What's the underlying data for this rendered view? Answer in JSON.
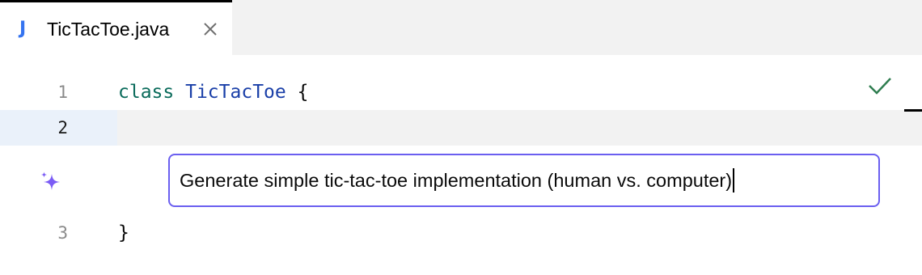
{
  "tab": {
    "icon_label": "J",
    "icon_color": "#3574f0",
    "title": "TicTacToe.java",
    "close_icon": "close-icon"
  },
  "editor": {
    "lines": [
      {
        "number": "1",
        "keyword": "class",
        "class_name": "TicTacToe",
        "rest": "{"
      },
      {
        "number": "2",
        "text": ""
      },
      {
        "number": "3",
        "text": "}"
      }
    ],
    "status_icon": "check-icon",
    "status_color": "#2e7d4f"
  },
  "ai_prompt": {
    "icon": "sparkle-icon",
    "icon_color": "#7b5cf5",
    "value": "Generate simple tic-tac-toe implementation (human vs. computer)",
    "border_color": "#6b5ff0"
  }
}
